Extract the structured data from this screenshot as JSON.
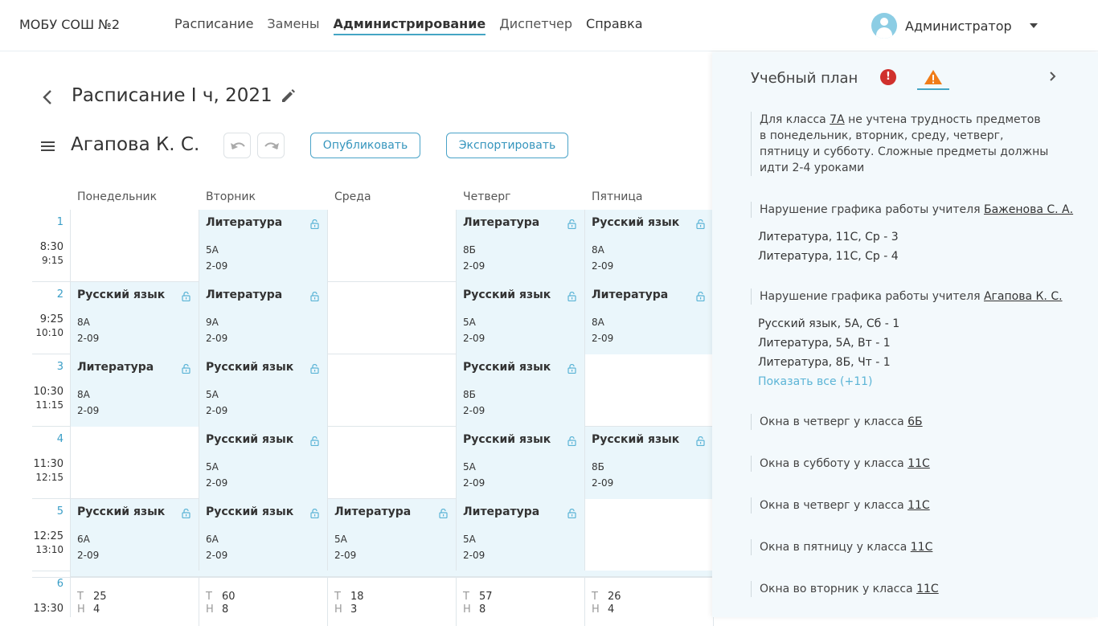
{
  "brand": "МОБУ СОШ №2",
  "nav": [
    "Расписание",
    "Замены",
    "Администрирование",
    "Диспетчер",
    "Справка"
  ],
  "user": "Администратор",
  "schedule_title": "Расписание I ч, 2021",
  "teacher": "Агапова К. С.",
  "publish_label": "Опубликовать",
  "export_label": "Экспортировать",
  "days": [
    "Понедельник",
    "Вторник",
    "Среда",
    "Четверг",
    "Пятница"
  ],
  "periods": [
    {
      "num": "1",
      "start": "8:30",
      "end": "9:15"
    },
    {
      "num": "2",
      "start": "9:25",
      "end": "10:10"
    },
    {
      "num": "3",
      "start": "10:30",
      "end": "11:15"
    },
    {
      "num": "4",
      "start": "11:30",
      "end": "12:15"
    },
    {
      "num": "5",
      "start": "12:25",
      "end": "13:10"
    },
    {
      "num": "6",
      "start": "13:30",
      "end": ""
    }
  ],
  "cells": [
    [
      null,
      {
        "subject": "Литература",
        "class": "5А",
        "room": "2-09"
      },
      null,
      {
        "subject": "Литература",
        "class": "8Б",
        "room": "2-09"
      },
      {
        "subject": "Русский язык",
        "class": "8А",
        "room": "2-09"
      }
    ],
    [
      {
        "subject": "Русский язык",
        "class": "8А",
        "room": "2-09"
      },
      {
        "subject": "Литература",
        "class": "9А",
        "room": "2-09"
      },
      null,
      {
        "subject": "Русский язык",
        "class": "5А",
        "room": "2-09"
      },
      {
        "subject": "Литература",
        "class": "8А",
        "room": "2-09"
      }
    ],
    [
      {
        "subject": "Литература",
        "class": "8А",
        "room": "2-09"
      },
      {
        "subject": "Русский язык",
        "class": "5А",
        "room": "2-09"
      },
      null,
      {
        "subject": "Русский язык",
        "class": "8Б",
        "room": "2-09"
      },
      null
    ],
    [
      null,
      {
        "subject": "Русский язык",
        "class": "5А",
        "room": "2-09"
      },
      null,
      {
        "subject": "Русский язык",
        "class": "5А",
        "room": "2-09"
      },
      {
        "subject": "Русский язык",
        "class": "8Б",
        "room": "2-09"
      }
    ],
    [
      {
        "subject": "Русский язык",
        "class": "6А",
        "room": "2-09"
      },
      {
        "subject": "Русский язык",
        "class": "6А",
        "room": "2-09"
      },
      {
        "subject": "Литература",
        "class": "5А",
        "room": "2-09"
      },
      {
        "subject": "Литература",
        "class": "5А",
        "room": "2-09"
      },
      null
    ]
  ],
  "summary": [
    {
      "t": "25",
      "n": "4"
    },
    {
      "t": "60",
      "n": "8"
    },
    {
      "t": "18",
      "n": "3"
    },
    {
      "t": "57",
      "n": "8"
    },
    {
      "t": "26",
      "n": "4"
    }
  ],
  "summary_labels": {
    "t": "Т",
    "n": "Н"
  },
  "panel": {
    "title": "Учебный план",
    "error_badge": "!",
    "issue1": {
      "pre": "Для класса ",
      "link": "7А",
      "post": " не учтена трудность предметов в понедельник, вторник, среду, четверг, пятницу и субботу. Сложные предметы должны идти 2-4 уроками"
    },
    "issue2": {
      "pre": "Нарушение графика работы учителя ",
      "link": "Баженова С. А.",
      "items": [
        "Литература, 11С, Ср - 3",
        "Литература, 11С, Ср - 4"
      ]
    },
    "issue3": {
      "pre": "Нарушение графика работы учителя ",
      "link": "Агапова К. С.",
      "items": [
        "Русский язык, 5А, Сб - 1",
        "Литература, 5А, Вт - 1",
        "Литература, 8Б, Чт - 1"
      ],
      "more": "Показать все (+11)"
    },
    "gaps": [
      {
        "pre": "Окна в четверг у класса ",
        "link": "6Б"
      },
      {
        "pre": "Окна в субботу у класса ",
        "link": "11С"
      },
      {
        "pre": "Окна в четверг у класса ",
        "link": "11С"
      },
      {
        "pre": "Окна в пятницу у класса ",
        "link": "11С"
      },
      {
        "pre": "Окна во вторник у класса ",
        "link": "11С"
      }
    ]
  }
}
